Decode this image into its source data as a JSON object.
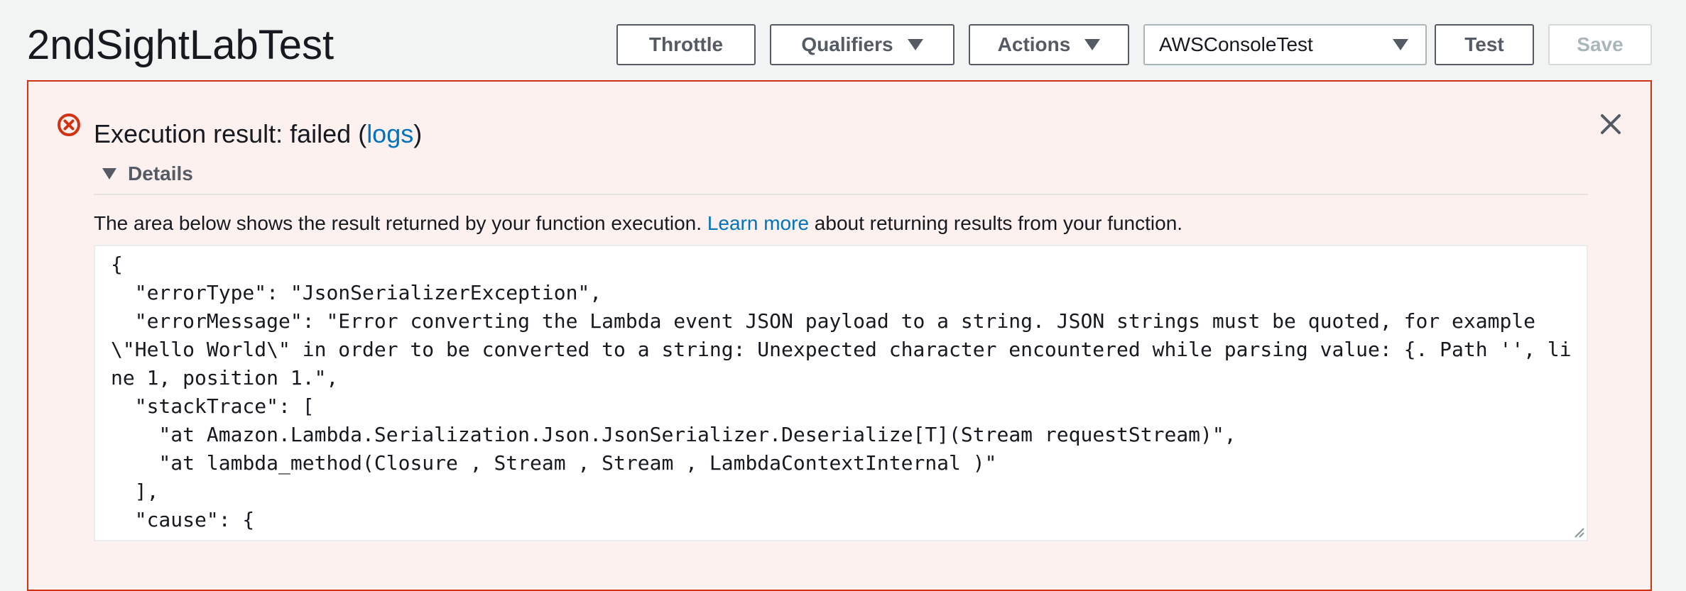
{
  "header": {
    "title": "2ndSightLabTest",
    "buttons": {
      "throttle": "Throttle",
      "qualifiers": "Qualifiers",
      "actions": "Actions",
      "test": "Test",
      "save": "Save"
    },
    "test_event_select": {
      "value": "AWSConsoleTest"
    }
  },
  "result_panel": {
    "title_prefix": "Execution result: failed (",
    "logs_link": "logs",
    "title_suffix": ")",
    "details_label": "Details",
    "description_prefix": "The area below shows the result returned by your function execution. ",
    "learn_more_link": "Learn more",
    "description_suffix": " about returning results from your function.",
    "output": "{\n  \"errorType\": \"JsonSerializerException\",\n  \"errorMessage\": \"Error converting the Lambda event JSON payload to a string. JSON strings must be quoted, for example \\\"Hello World\\\" in order to be converted to a string: Unexpected character encountered while parsing value: {. Path '', line 1, position 1.\",\n  \"stackTrace\": [\n    \"at Amazon.Lambda.Serialization.Json.JsonSerializer.Deserialize[T](Stream requestStream)\",\n    \"at lambda_method(Closure , Stream , Stream , LambdaContextInternal )\"\n  ],\n  \"cause\": {\n    \"errorType\": \"JsonReaderException\","
  },
  "icons": {
    "error": "error-circle-icon",
    "close": "close-icon",
    "caret": "caret-down-icon",
    "resize": "resize-handle-icon"
  },
  "colors": {
    "error_border": "#d13212",
    "error_background": "#fdf1ef",
    "link": "#0073bb",
    "button_border": "#545b64",
    "disabled": "#aab7b8"
  }
}
